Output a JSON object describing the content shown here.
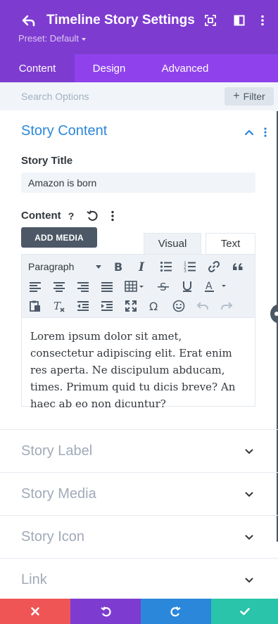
{
  "header": {
    "title": "Timeline Story Settings",
    "preset": "Preset: Default",
    "icons": [
      "back-arrow-icon",
      "fullscreen-icon",
      "split-view-icon",
      "more-vertical-icon"
    ]
  },
  "tabs": [
    {
      "label": "Content",
      "active": true
    },
    {
      "label": "Design",
      "active": false
    },
    {
      "label": "Advanced",
      "active": false
    }
  ],
  "search": {
    "placeholder": "Search Options",
    "filter_label": "Filter"
  },
  "content_section": {
    "title": "Story Content",
    "story_title_label": "Story Title",
    "story_title_value": "Amazon is born",
    "content_label": "Content",
    "help_glyph": "?",
    "add_media_label": "ADD MEDIA",
    "editor_tabs": {
      "visual": "Visual",
      "text": "Text",
      "active": "visual"
    },
    "format_select": "Paragraph",
    "body_text": "Lorem ipsum dolor sit amet, consectetur adipiscing elit. Erat enim res aperta. Ne discipulum abducam, times. Primum quid tu dicis breve? An haec ab eo non dicuntur?"
  },
  "collapsed_sections": [
    {
      "title": "Story Label"
    },
    {
      "title": "Story Media"
    },
    {
      "title": "Story Icon"
    },
    {
      "title": "Link"
    }
  ],
  "footer": {
    "buttons": [
      "cancel-icon",
      "undo-icon",
      "redo-icon",
      "save-check-icon"
    ]
  },
  "colors": {
    "header_purple": "#7e3bd0",
    "tab_purple": "#8f42ec",
    "accent_blue": "#2b87da",
    "cancel_red": "#ef5555",
    "save_green": "#29c4a9"
  }
}
